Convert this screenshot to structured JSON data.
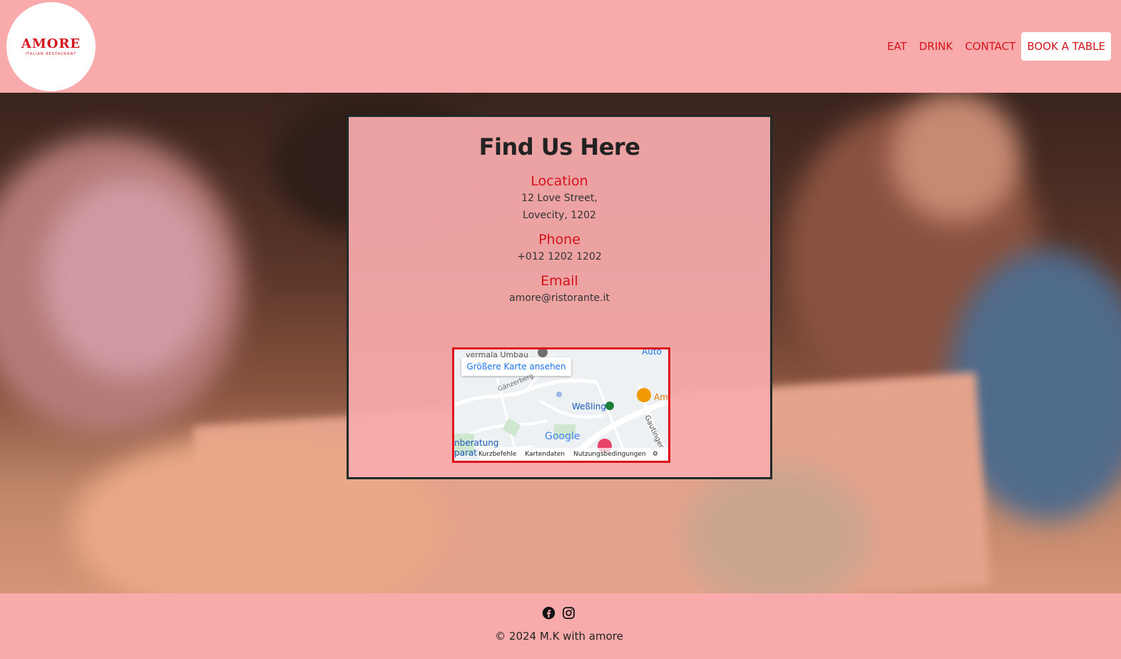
{
  "brand": {
    "name": "AMORE",
    "tagline": "ITALIAN RESTAURANT",
    "accent": "#d4131b",
    "background": "#f9abac"
  },
  "nav": {
    "items": [
      {
        "label": "EAT"
      },
      {
        "label": "DRINK"
      },
      {
        "label": "CONTACT"
      }
    ],
    "cta_label": "BOOK A TABLE"
  },
  "contact": {
    "title": "Find Us Here",
    "location": {
      "title": "Location",
      "line1": "12 Love Street,",
      "line2": "Lovecity, 1202"
    },
    "phone": {
      "title": "Phone",
      "value": "+012 1202 1202"
    },
    "email": {
      "title": "Email",
      "value": "amore@ristorante.it"
    }
  },
  "map": {
    "larger_map_label": "Größere Karte ansehen",
    "places": {
      "town": "Weßling",
      "street1": "Gänzerberg",
      "street2": "Gautinger",
      "poi": "Am",
      "google": "Google",
      "top_left": "vermala Umbau",
      "top_right": "Auto",
      "bottom_left1": "nberatung",
      "bottom_left2": "parat"
    },
    "footer": {
      "shortcuts": "Kurzbefehle",
      "map_data": "Kartendaten",
      "terms": "Nutzungsbedingungen"
    }
  },
  "footer": {
    "icons": [
      "facebook-icon",
      "instagram-icon"
    ],
    "copyright": "© 2024 M.K with amore"
  }
}
